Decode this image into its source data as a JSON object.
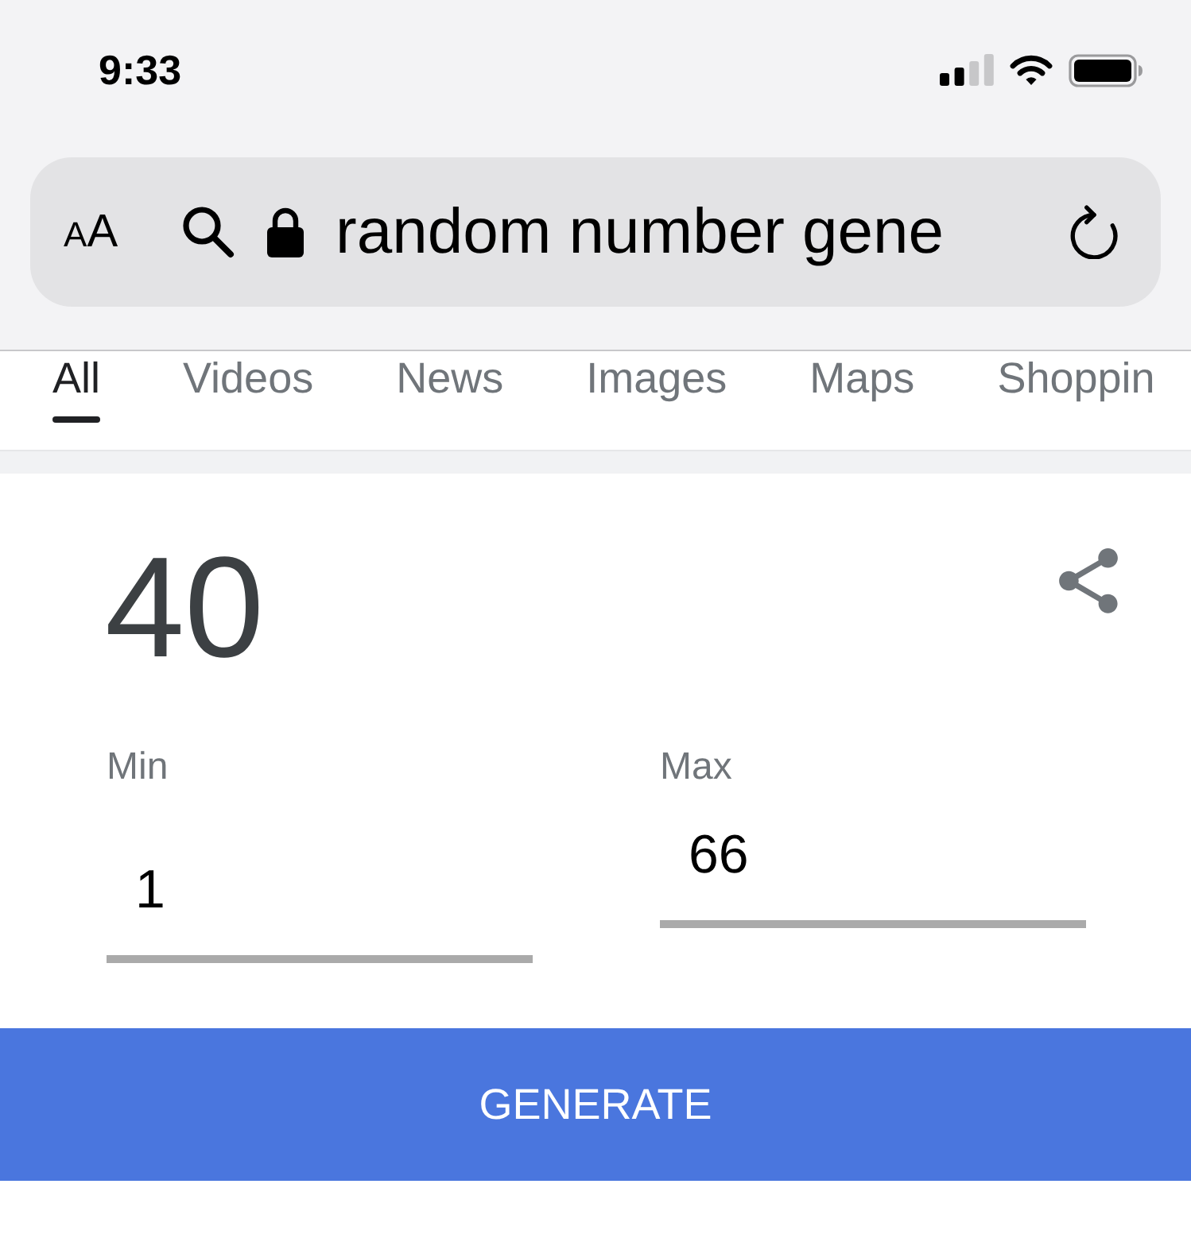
{
  "status_bar": {
    "time": "9:33"
  },
  "address_bar": {
    "text_size_button": "AA",
    "url": "random number gene"
  },
  "tabs": [
    {
      "label": "All",
      "selected": true
    },
    {
      "label": "Videos",
      "selected": false
    },
    {
      "label": "News",
      "selected": false
    },
    {
      "label": "Images",
      "selected": false
    },
    {
      "label": "Maps",
      "selected": false
    },
    {
      "label": "Shoppin",
      "selected": false
    }
  ],
  "result": {
    "number": "40"
  },
  "fields": [
    {
      "label": "Min",
      "value": "1"
    },
    {
      "label": "Max",
      "value": "66"
    }
  ],
  "generate_button": {
    "label": "GENERATE"
  }
}
